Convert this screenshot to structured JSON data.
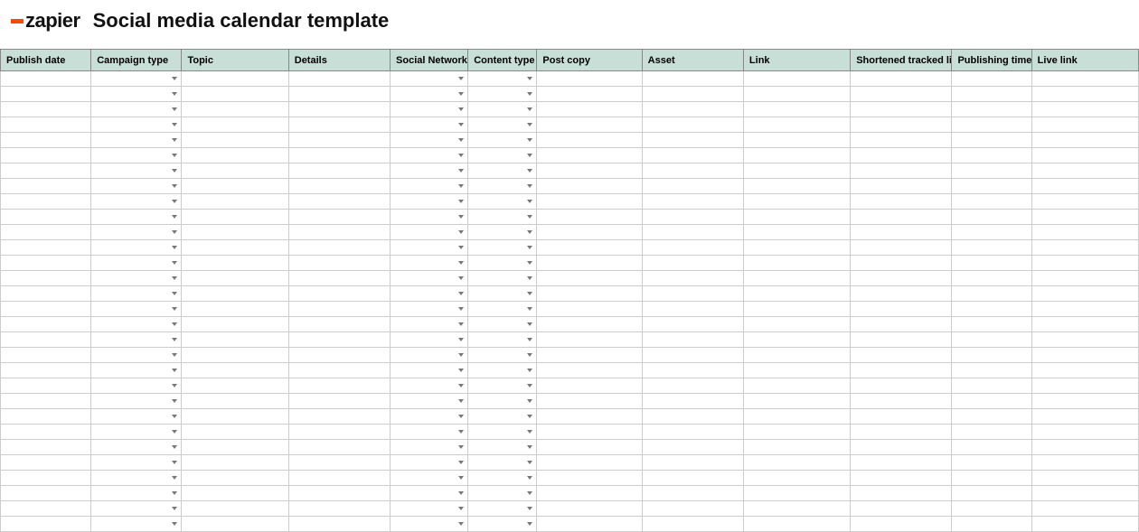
{
  "header": {
    "logo_text": "zapier",
    "title": "Social media calendar template"
  },
  "table": {
    "columns": [
      {
        "label": "Publish date",
        "dropdown": false
      },
      {
        "label": "Campaign type",
        "dropdown": true
      },
      {
        "label": "Topic",
        "dropdown": false
      },
      {
        "label": "Details",
        "dropdown": false
      },
      {
        "label": "Social Network",
        "dropdown": true
      },
      {
        "label": "Content type",
        "dropdown": true
      },
      {
        "label": "Post copy",
        "dropdown": false
      },
      {
        "label": "Asset",
        "dropdown": false
      },
      {
        "label": "Link",
        "dropdown": false
      },
      {
        "label": "Shortened tracked link",
        "dropdown": false
      },
      {
        "label": "Publishing time",
        "dropdown": false
      },
      {
        "label": "Live link",
        "dropdown": false
      }
    ],
    "row_count": 30
  }
}
